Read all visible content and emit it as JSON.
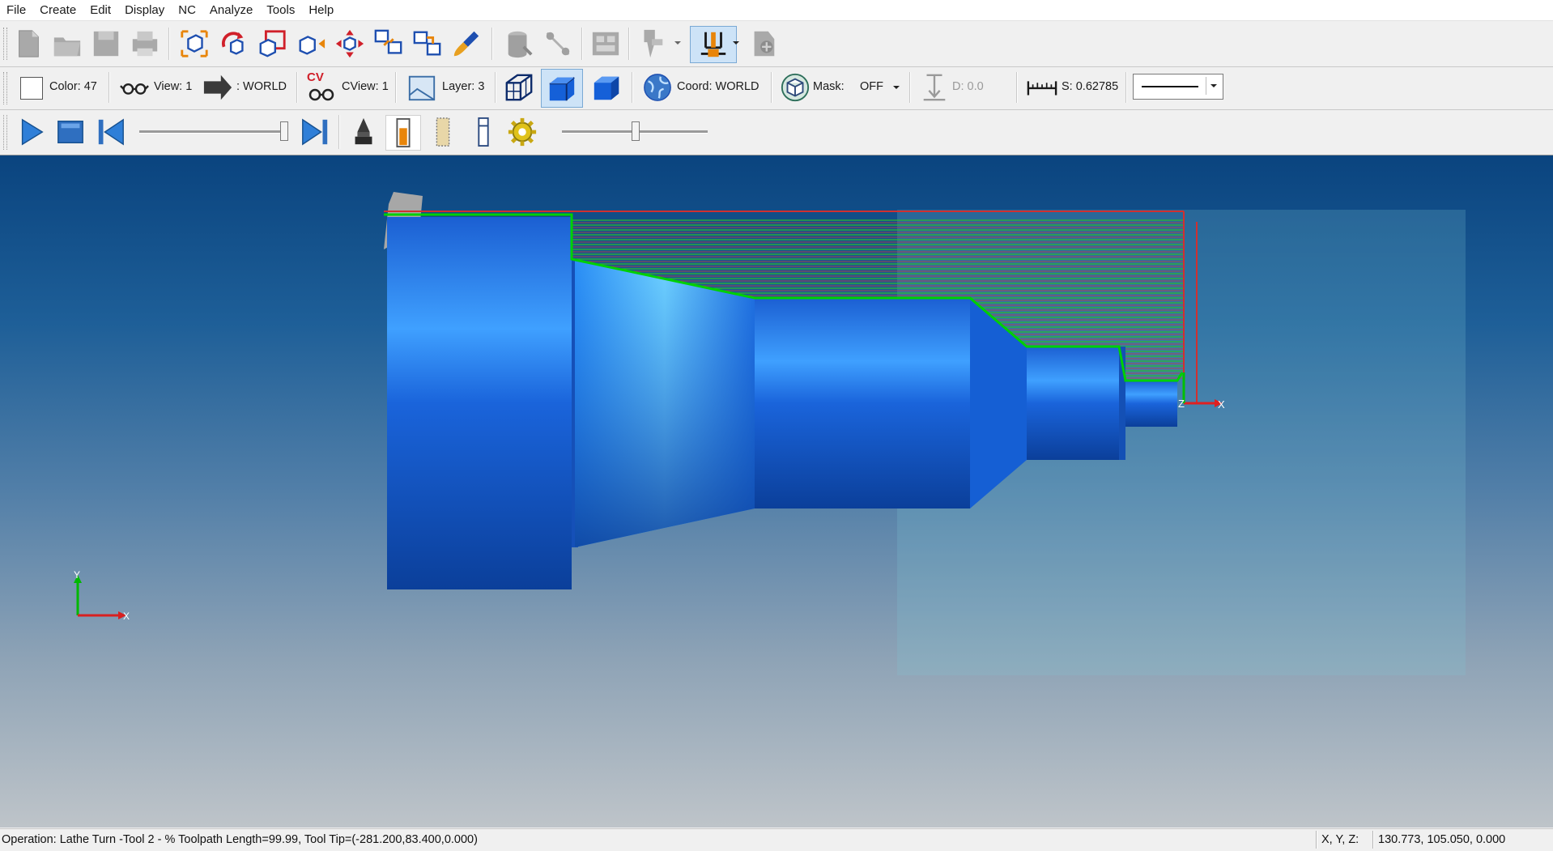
{
  "menu": [
    "File",
    "Create",
    "Edit",
    "Display",
    "NC",
    "Analyze",
    "Tools",
    "Help"
  ],
  "props": {
    "color": "Color: 47",
    "view": "View: 1",
    "world": ": WORLD",
    "cview_badge": "CV",
    "cview": "CView: 1",
    "layer": "Layer: 3",
    "coord": "Coord: WORLD",
    "mask_label": "Mask:",
    "mask_value": "OFF",
    "depth": "D: 0.0",
    "scale": "S: 0.62785"
  },
  "simulation": {
    "progress": 1.0,
    "speed": 0.5
  },
  "viewport": {
    "axis_triad": {
      "y": "Y",
      "x": "X"
    },
    "origin_marker": {
      "z": "Z",
      "x": "X"
    }
  },
  "status": {
    "operation": "Operation: Lathe Turn   -Tool 2 - % Toolpath Length=99.99, Tool Tip=(-281.200,83.400,0.000)",
    "xyz_label": "X, Y, Z:",
    "xyz_value": "130.773, 105.050, 0.000"
  },
  "colors": {
    "part_blue": "#1560d8",
    "toolpath_green": "#00d000",
    "toolpath_red": "#d03030",
    "viewport_top": "#0a447f",
    "viewport_bottom": "#bec4c9"
  },
  "icons": {
    "file_new": "new-file-icon",
    "open": "open-folder-icon",
    "save": "save-icon",
    "print": "print-icon",
    "play": "play-icon",
    "stop": "stop-icon",
    "rewind": "rewind-icon",
    "fast_forward": "skip-end-icon"
  }
}
